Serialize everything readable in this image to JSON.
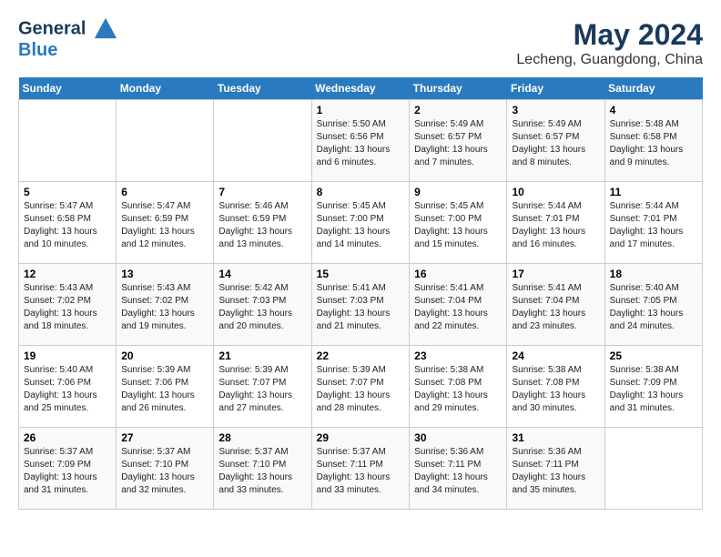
{
  "header": {
    "logo_line1": "General",
    "logo_line2": "Blue",
    "month_year": "May 2024",
    "location": "Lecheng, Guangdong, China"
  },
  "days_of_week": [
    "Sunday",
    "Monday",
    "Tuesday",
    "Wednesday",
    "Thursday",
    "Friday",
    "Saturday"
  ],
  "weeks": [
    [
      {
        "day": "",
        "info": ""
      },
      {
        "day": "",
        "info": ""
      },
      {
        "day": "",
        "info": ""
      },
      {
        "day": "1",
        "info": "Sunrise: 5:50 AM\nSunset: 6:56 PM\nDaylight: 13 hours\nand 6 minutes."
      },
      {
        "day": "2",
        "info": "Sunrise: 5:49 AM\nSunset: 6:57 PM\nDaylight: 13 hours\nand 7 minutes."
      },
      {
        "day": "3",
        "info": "Sunrise: 5:49 AM\nSunset: 6:57 PM\nDaylight: 13 hours\nand 8 minutes."
      },
      {
        "day": "4",
        "info": "Sunrise: 5:48 AM\nSunset: 6:58 PM\nDaylight: 13 hours\nand 9 minutes."
      }
    ],
    [
      {
        "day": "5",
        "info": "Sunrise: 5:47 AM\nSunset: 6:58 PM\nDaylight: 13 hours\nand 10 minutes."
      },
      {
        "day": "6",
        "info": "Sunrise: 5:47 AM\nSunset: 6:59 PM\nDaylight: 13 hours\nand 12 minutes."
      },
      {
        "day": "7",
        "info": "Sunrise: 5:46 AM\nSunset: 6:59 PM\nDaylight: 13 hours\nand 13 minutes."
      },
      {
        "day": "8",
        "info": "Sunrise: 5:45 AM\nSunset: 7:00 PM\nDaylight: 13 hours\nand 14 minutes."
      },
      {
        "day": "9",
        "info": "Sunrise: 5:45 AM\nSunset: 7:00 PM\nDaylight: 13 hours\nand 15 minutes."
      },
      {
        "day": "10",
        "info": "Sunrise: 5:44 AM\nSunset: 7:01 PM\nDaylight: 13 hours\nand 16 minutes."
      },
      {
        "day": "11",
        "info": "Sunrise: 5:44 AM\nSunset: 7:01 PM\nDaylight: 13 hours\nand 17 minutes."
      }
    ],
    [
      {
        "day": "12",
        "info": "Sunrise: 5:43 AM\nSunset: 7:02 PM\nDaylight: 13 hours\nand 18 minutes."
      },
      {
        "day": "13",
        "info": "Sunrise: 5:43 AM\nSunset: 7:02 PM\nDaylight: 13 hours\nand 19 minutes."
      },
      {
        "day": "14",
        "info": "Sunrise: 5:42 AM\nSunset: 7:03 PM\nDaylight: 13 hours\nand 20 minutes."
      },
      {
        "day": "15",
        "info": "Sunrise: 5:41 AM\nSunset: 7:03 PM\nDaylight: 13 hours\nand 21 minutes."
      },
      {
        "day": "16",
        "info": "Sunrise: 5:41 AM\nSunset: 7:04 PM\nDaylight: 13 hours\nand 22 minutes."
      },
      {
        "day": "17",
        "info": "Sunrise: 5:41 AM\nSunset: 7:04 PM\nDaylight: 13 hours\nand 23 minutes."
      },
      {
        "day": "18",
        "info": "Sunrise: 5:40 AM\nSunset: 7:05 PM\nDaylight: 13 hours\nand 24 minutes."
      }
    ],
    [
      {
        "day": "19",
        "info": "Sunrise: 5:40 AM\nSunset: 7:06 PM\nDaylight: 13 hours\nand 25 minutes."
      },
      {
        "day": "20",
        "info": "Sunrise: 5:39 AM\nSunset: 7:06 PM\nDaylight: 13 hours\nand 26 minutes."
      },
      {
        "day": "21",
        "info": "Sunrise: 5:39 AM\nSunset: 7:07 PM\nDaylight: 13 hours\nand 27 minutes."
      },
      {
        "day": "22",
        "info": "Sunrise: 5:39 AM\nSunset: 7:07 PM\nDaylight: 13 hours\nand 28 minutes."
      },
      {
        "day": "23",
        "info": "Sunrise: 5:38 AM\nSunset: 7:08 PM\nDaylight: 13 hours\nand 29 minutes."
      },
      {
        "day": "24",
        "info": "Sunrise: 5:38 AM\nSunset: 7:08 PM\nDaylight: 13 hours\nand 30 minutes."
      },
      {
        "day": "25",
        "info": "Sunrise: 5:38 AM\nSunset: 7:09 PM\nDaylight: 13 hours\nand 31 minutes."
      }
    ],
    [
      {
        "day": "26",
        "info": "Sunrise: 5:37 AM\nSunset: 7:09 PM\nDaylight: 13 hours\nand 31 minutes."
      },
      {
        "day": "27",
        "info": "Sunrise: 5:37 AM\nSunset: 7:10 PM\nDaylight: 13 hours\nand 32 minutes."
      },
      {
        "day": "28",
        "info": "Sunrise: 5:37 AM\nSunset: 7:10 PM\nDaylight: 13 hours\nand 33 minutes."
      },
      {
        "day": "29",
        "info": "Sunrise: 5:37 AM\nSunset: 7:11 PM\nDaylight: 13 hours\nand 33 minutes."
      },
      {
        "day": "30",
        "info": "Sunrise: 5:36 AM\nSunset: 7:11 PM\nDaylight: 13 hours\nand 34 minutes."
      },
      {
        "day": "31",
        "info": "Sunrise: 5:36 AM\nSunset: 7:11 PM\nDaylight: 13 hours\nand 35 minutes."
      },
      {
        "day": "",
        "info": ""
      }
    ]
  ]
}
